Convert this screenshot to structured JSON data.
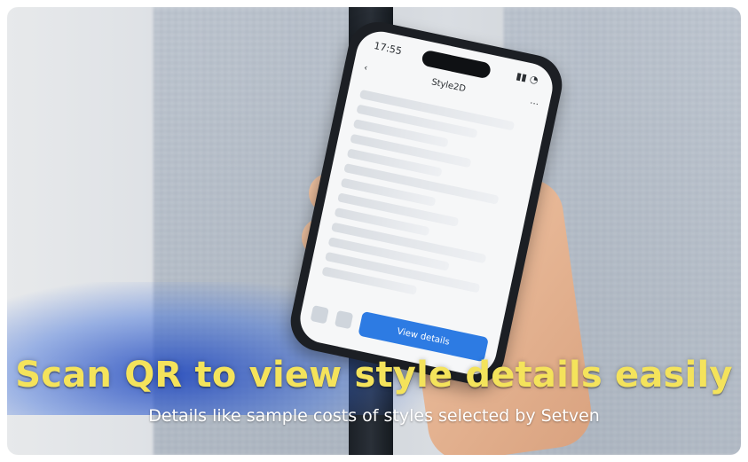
{
  "phone": {
    "time": "17:55",
    "screen_title": "Style2D",
    "view_button": "View details"
  },
  "captions": {
    "headline": "Scan QR to view style details easily",
    "subline": "Details like sample costs of styles selected by Setven"
  }
}
